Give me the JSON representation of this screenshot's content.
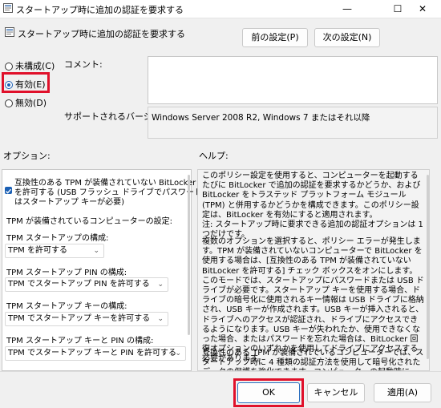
{
  "window": {
    "title": "スタートアップ時に追加の認証を要求する",
    "minimize": "—",
    "maximize": "☐",
    "close": "✕"
  },
  "header": {
    "policy_name": "スタートアップ時に追加の認証を要求する",
    "prev_button": "前の設定(P)",
    "next_button": "次の設定(N)"
  },
  "state": {
    "options": [
      {
        "label": "未構成(C)",
        "selected": false
      },
      {
        "label": "有効(E)",
        "selected": true
      },
      {
        "label": "無効(D)",
        "selected": false
      }
    ],
    "comment_label": "コメント:",
    "comment_value": "",
    "supported_label": "サポートされるバージョン:",
    "supported_value": "Windows Server 2008 R2, Windows 7 またはそれ以降"
  },
  "options_label": "オプション:",
  "help_label": "ヘルプ:",
  "options_panel": {
    "checkbox_label_1": "互換性のある TPM が装備されていない BitLocker",
    "checkbox_label_2": "を許可する (USB フラッシュ ドライブでパスワードまた",
    "checkbox_label_3": "はスタートアップ キーが必要)",
    "checkbox_checked": true,
    "tpm_computers_label": "TPM が装備されているコンピューターの設定:",
    "tpm_startup_label": "TPM スタートアップの構成:",
    "tpm_startup_value": "TPM を許可する",
    "tpm_pin_label": "TPM スタートアップ PIN の構成:",
    "tpm_pin_value": "TPM でスタートアップ PIN を許可する",
    "tpm_key_label": "TPM スタートアップ キーの構成:",
    "tpm_key_value": "TPM でスタートアップ キーを許可する",
    "tpm_key_pin_label": "TPM スタートアップ キーと PIN の構成:",
    "tpm_key_pin_value": "TPM でスタートアップ キーと PIN を許可する"
  },
  "help_panel": {
    "p1": "このポリシー設定を使用すると、コンピューターを起動するたびに BitLocker で追加の認証を要求するかどうか、および BitLocker をトラステッド プラットフォーム モジュール (TPM) と併用するかどうかを構成できます。このポリシー設定は、BitLocker を有効にすると適用されます。",
    "p2": "注: スタートアップ時に要求できる追加の認証オプションは 1 つだけです。",
    "p3": "複数のオプションを選択すると、ポリシー エラーが発生します。TPM が装備されていないコンピューターで BitLocker を使用する場合は、[互換性のある TPM が装備されていない BitLocker を許可する] チェック ボックスをオンにします。このモードでは、スタートアップにパスワードまたは USB ドライブが必要です。スタートアップ キーを使用する場合、ドライブの暗号化に使用されるキー情報は USB ドライブに格納され、USB キーが作成されます。USB キーが挿入されると、ドライブへのアクセスが認証され、ドライブにアクセスできるようになります。USB キーが失われたか、使用できなくなった場合、またはパスワードを忘れた場合は、BitLocker 回復オプションのいずれかを使用してドライブにアクセスする必要があります。",
    "p4": "互換性のある TPM が装備されているコンピューターでは、スタートアップ時に 4 種類の認証方法を使用して暗号化されたデータの保護を強化できます。コンピューターの起動時に、認証に TPM のみを使用することも、ス"
  },
  "footer": {
    "ok_button": "OK",
    "cancel_button": "キャンセル",
    "apply_button": "適用(A)"
  },
  "colors": {
    "highlight_red": "#e0102a",
    "accent_blue": "#1a5fb4"
  }
}
